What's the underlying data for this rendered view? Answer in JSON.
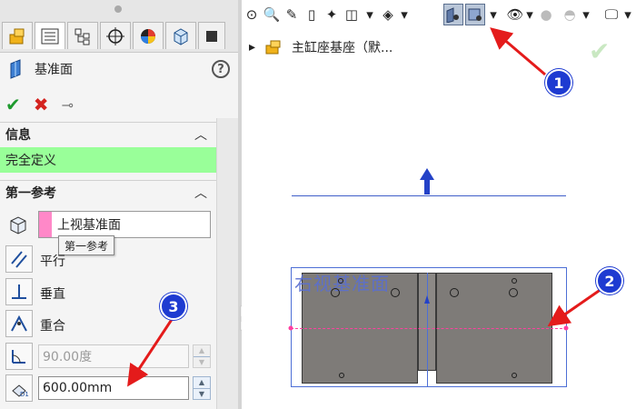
{
  "property_manager": {
    "title": "基准面",
    "help": "?",
    "info_section": {
      "title": "信息",
      "status": "完全定义"
    },
    "first_reference": {
      "title": "第一参考",
      "selection": "上视基准面",
      "tooltip": "第一参考",
      "options": {
        "parallel": "平行",
        "perpendicular": "垂直",
        "coincident": "重合"
      },
      "angle": "90.00度",
      "distance": "600.00mm"
    }
  },
  "feature_tree": {
    "expand_icon": "▸",
    "part_name": "主缸座基座（默..."
  },
  "graphics": {
    "plane_label": "右视基准面"
  },
  "callouts": {
    "c1": "1",
    "c2": "2",
    "c3": "3"
  },
  "colors": {
    "status_green": "#99ff99",
    "callout_blue": "#1e3bd1",
    "arrow_red": "#e41b1b",
    "plane_blue": "#3f5ec9",
    "plate_gray": "#7e7b78"
  }
}
